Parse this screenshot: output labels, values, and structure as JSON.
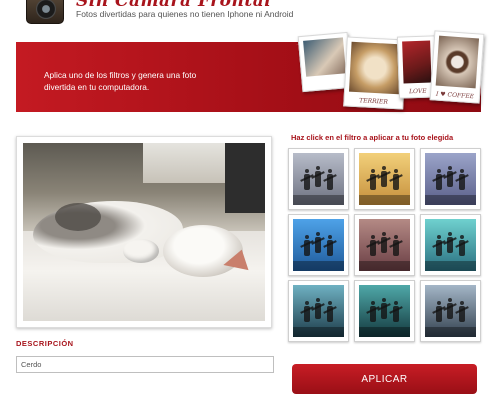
{
  "header": {
    "title": "Sin Camara Frontal",
    "tagline": "Fotos divertidas para quienes no tienen Iphone ni Android"
  },
  "banner": {
    "text": "Aplica uno de los filtros y genera una foto divertida en tu computadora.",
    "polaroids": [
      {
        "caption": ""
      },
      {
        "caption": "TERRIER"
      },
      {
        "caption": "LOVE"
      },
      {
        "caption": "I ♥ COFFEE"
      }
    ]
  },
  "photo": {
    "alt": "Gato durmiendo"
  },
  "description": {
    "label": "DESCRIPCIÓN",
    "value": "Cerdo"
  },
  "filters": {
    "title": "Haz click en el filtro a aplicar a tu foto elegida",
    "items": [
      {
        "name": "filter-1",
        "sky_top": "#b7bcc9",
        "sky_bottom": "#6d7180"
      },
      {
        "name": "filter-2",
        "sky_top": "#f2d07a",
        "sky_bottom": "#c58f3c"
      },
      {
        "name": "filter-3",
        "sky_top": "#9ba4c9",
        "sky_bottom": "#5a5f8a"
      },
      {
        "name": "filter-4",
        "sky_top": "#4ea2e8",
        "sky_bottom": "#1f5a9a"
      },
      {
        "name": "filter-5",
        "sky_top": "#b48a85",
        "sky_bottom": "#6a3e44"
      },
      {
        "name": "filter-6",
        "sky_top": "#6fd1cf",
        "sky_bottom": "#2a6f80"
      },
      {
        "name": "filter-7",
        "sky_top": "#6fb1c2",
        "sky_bottom": "#1d3c4a"
      },
      {
        "name": "filter-8",
        "sky_top": "#4fa8a8",
        "sky_bottom": "#14393f"
      },
      {
        "name": "filter-9",
        "sky_top": "#a4b6c7",
        "sky_bottom": "#33414f"
      }
    ]
  },
  "apply_button": {
    "label": "APLICAR"
  },
  "colors": {
    "accent": "#a8141c",
    "banner": "#b5151d"
  }
}
